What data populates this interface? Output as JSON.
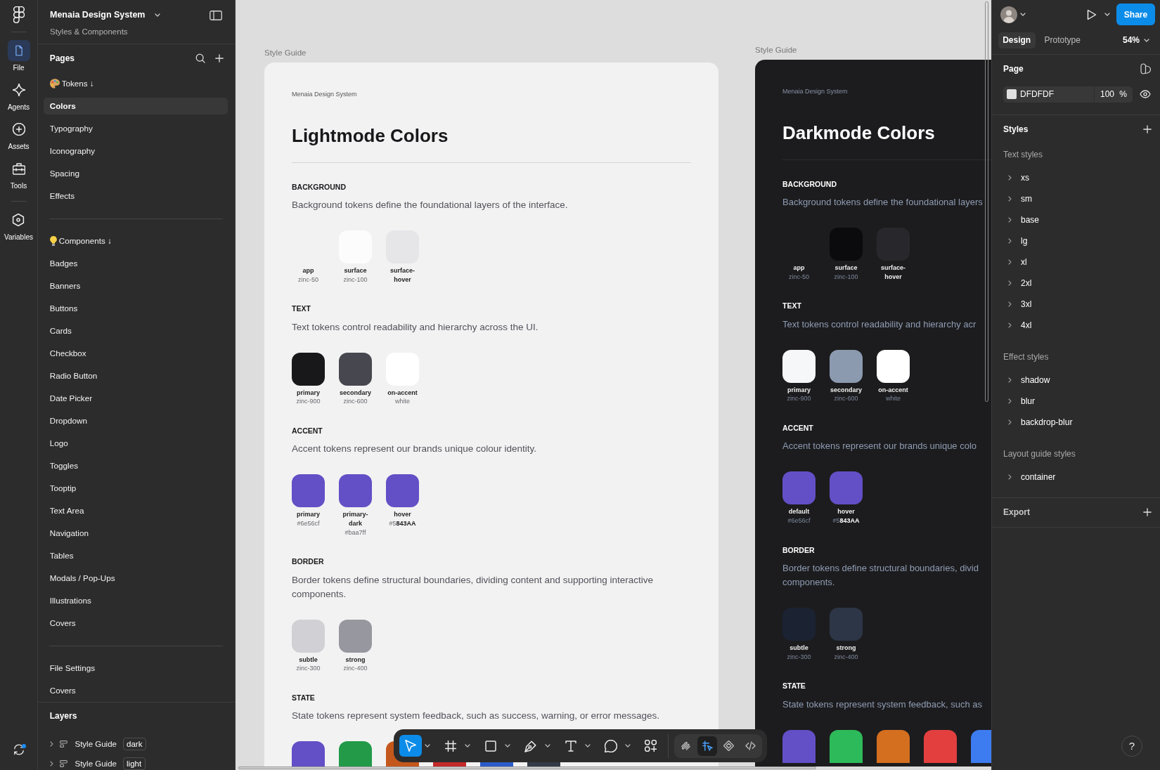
{
  "rail": {
    "items": [
      {
        "label": "File",
        "selected": true
      },
      {
        "label": "Agents",
        "selected": false
      },
      {
        "label": "Assets",
        "selected": false
      },
      {
        "label": "Tools",
        "selected": false
      },
      {
        "label": "Variables",
        "selected": false
      }
    ],
    "sync": {
      "notification": true
    }
  },
  "sidebar": {
    "file_name": "Menaia Design System",
    "file_subtitle": "Styles & Components",
    "pages_title": "Pages",
    "page_groups": [
      {
        "items": [
          {
            "label": "Tokens ↓",
            "kind": "section",
            "selected": false
          },
          {
            "label": "Colors",
            "kind": "page",
            "selected": true
          },
          {
            "label": "Typography",
            "kind": "page",
            "selected": false
          },
          {
            "label": "Iconography",
            "kind": "page",
            "selected": false
          },
          {
            "label": "Spacing",
            "kind": "page",
            "selected": false
          },
          {
            "label": "Effects",
            "kind": "page",
            "selected": false
          }
        ]
      },
      {
        "items": [
          {
            "label": "Components ↓",
            "kind": "section",
            "selected": false
          },
          {
            "label": "Badges",
            "kind": "page",
            "selected": false
          },
          {
            "label": "Banners",
            "kind": "page",
            "selected": false
          },
          {
            "label": "Buttons",
            "kind": "page",
            "selected": false
          },
          {
            "label": "Cards",
            "kind": "page",
            "selected": false
          },
          {
            "label": "Checkbox",
            "kind": "page",
            "selected": false
          },
          {
            "label": "Radio Button",
            "kind": "page",
            "selected": false
          },
          {
            "label": "Date Picker",
            "kind": "page",
            "selected": false
          },
          {
            "label": "Dropdown",
            "kind": "page",
            "selected": false
          },
          {
            "label": "Logo",
            "kind": "page",
            "selected": false
          },
          {
            "label": "Toggles",
            "kind": "page",
            "selected": false
          },
          {
            "label": "Tooptip",
            "kind": "page",
            "selected": false
          },
          {
            "label": "Text Area",
            "kind": "page",
            "selected": false
          },
          {
            "label": "Navigation",
            "kind": "page",
            "selected": false
          },
          {
            "label": "Tables",
            "kind": "page",
            "selected": false
          },
          {
            "label": "Modals / Pop-Ups",
            "kind": "page",
            "selected": false
          },
          {
            "label": "Illustrations",
            "kind": "page",
            "selected": false
          },
          {
            "label": "Covers",
            "kind": "page",
            "selected": false
          }
        ]
      },
      {
        "items": [
          {
            "label": "File Settings",
            "kind": "page",
            "selected": false
          },
          {
            "label": "Covers",
            "kind": "page",
            "selected": false
          }
        ]
      }
    ],
    "layers_title": "Layers",
    "layers": [
      {
        "name": "Style Guide",
        "tag": "dark",
        "expanded": false
      },
      {
        "name": "Style Guide",
        "tag": "light",
        "expanded": false
      }
    ]
  },
  "canvas": {
    "frames": [
      {
        "label": "Style Guide",
        "kind": "light",
        "brand": "Menaia Design System",
        "title": "Lightmode Colors",
        "sections": [
          {
            "heading": "BACKGROUND",
            "description": "Background tokens define the foundational layers of the interface.",
            "swatches": [
              {
                "name": "app",
                "value": "zinc-50"
              },
              {
                "name": "surface",
                "value": "zinc-100",
                "color": "#fcfcfc"
              },
              {
                "name": "surface-hover",
                "color": "#e6e6e9"
              }
            ]
          },
          {
            "heading": "TEXT",
            "description": "Text tokens control readability and hierarchy across the UI.",
            "swatches": [
              {
                "name": "primary",
                "value": "zinc-900",
                "color": "#18181b"
              },
              {
                "name": "secondary",
                "value": "zinc-600",
                "color": "#47474f"
              },
              {
                "name": "on-accent",
                "value": "white",
                "color": "#ffffff"
              }
            ]
          },
          {
            "heading": "ACCENT",
            "description": "Accent tokens represent our brands unique colour identity.",
            "swatches": [
              {
                "name": "primary",
                "value": "#6e56cf",
                "color": "#634fc6"
              },
              {
                "name": "primary-dark",
                "value": "#baa7ff",
                "color": "#634fc6"
              },
              {
                "name": "hover",
                "value": "#5**843AA**",
                "color": "#634fc6"
              }
            ]
          },
          {
            "heading": "BORDER",
            "description": "Border tokens define structural boundaries, dividing content and supporting interactive components.",
            "swatches": [
              {
                "name": "subtle",
                "value": "zinc-300",
                "color": "#d0d0d5"
              },
              {
                "name": "strong",
                "value": "zinc-400",
                "color": "#97979f"
              }
            ]
          },
          {
            "heading": "STATE",
            "description": "State tokens represent system feedback, such as success, warning, or error messages.",
            "swatches": [
              {
                "color": "#634fc6"
              },
              {
                "color": "#229a48"
              },
              {
                "color": "#c4581c"
              },
              {
                "color": "#c42a2a"
              },
              {
                "color": "#2a5bc9"
              },
              {
                "color": "#333b47"
              }
            ]
          }
        ]
      },
      {
        "label": "Style Guide",
        "kind": "dark",
        "brand": "Menaia Design System",
        "title": "Darkmode Colors",
        "sections": [
          {
            "heading": "BACKGROUND",
            "description": "Background tokens define the foundational layers",
            "swatches": [
              {
                "name": "app",
                "value": "zinc-50"
              },
              {
                "name": "surface",
                "value": "zinc-100",
                "color": "#0b0b0d"
              },
              {
                "name": "surface-hover",
                "color": "#28282c"
              }
            ]
          },
          {
            "heading": "TEXT",
            "description": "Text tokens control readability and hierarchy acr",
            "swatches": [
              {
                "name": "primary",
                "value": "zinc-900",
                "color": "#f6f7f9"
              },
              {
                "name": "secondary",
                "value": "zinc-600",
                "color": "#8c9ab0"
              },
              {
                "name": "on-accent",
                "value": "white",
                "color": "#ffffff"
              }
            ]
          },
          {
            "heading": "ACCENT",
            "description": "Accent tokens represent our brands unique colo",
            "swatches": [
              {
                "name": "default",
                "value": "#6e56cf",
                "color": "#634fc6"
              },
              {
                "name": "hover",
                "value": "#5**843AA**",
                "color": "#634fc6"
              }
            ]
          },
          {
            "heading": "BORDER",
            "description": "Border tokens define structural boundaries, divid\ncomponents.",
            "swatches": [
              {
                "name": "subtle",
                "value": "zinc-300",
                "color": "#1b2232"
              },
              {
                "name": "strong",
                "value": "zinc-400",
                "color": "#2c3647"
              }
            ]
          },
          {
            "heading": "STATE",
            "description": "State tokens represent system feedback, such as",
            "swatches": [
              {
                "color": "#634fc6"
              },
              {
                "color": "#2dba5a"
              },
              {
                "color": "#d46f1f"
              },
              {
                "color": "#e33f3f"
              },
              {
                "color": "#3d7cf0"
              }
            ]
          }
        ]
      }
    ]
  },
  "toolbar": {
    "tools": [
      {
        "selected": true,
        "menu": true
      },
      {
        "selected": false,
        "menu": true
      },
      {
        "selected": false,
        "menu": true
      },
      {
        "selected": false,
        "menu": true
      },
      {
        "selected": false,
        "menu": true
      },
      {
        "selected": false,
        "menu": true
      },
      {
        "selected": false,
        "menu": false
      }
    ],
    "modes": [
      {
        "selected": false
      },
      {
        "selected": true
      },
      {
        "selected": false
      },
      {
        "selected": false
      }
    ]
  },
  "inspector": {
    "share": "Share",
    "tabs": [
      {
        "label": "Design",
        "selected": true
      },
      {
        "label": "Prototype",
        "selected": false
      }
    ],
    "zoom": "54%",
    "page": {
      "title": "Page",
      "hex": "DFDFDF",
      "opacity": "100",
      "unit": "%"
    },
    "styles": {
      "title": "Styles",
      "groups": [
        {
          "title": "Text styles",
          "items": [
            {
              "label": "xs",
              "expanded": false
            },
            {
              "label": "sm",
              "expanded": false
            },
            {
              "label": "base",
              "expanded": false
            },
            {
              "label": "lg",
              "expanded": false
            },
            {
              "label": "xl",
              "expanded": false
            },
            {
              "label": "2xl",
              "expanded": false
            },
            {
              "label": "3xl",
              "expanded": false
            },
            {
              "label": "4xl",
              "expanded": false
            }
          ]
        },
        {
          "title": "Effect styles",
          "items": [
            {
              "label": "shadow",
              "expanded": false
            },
            {
              "label": "blur",
              "expanded": false
            },
            {
              "label": "backdrop-blur",
              "expanded": false
            }
          ]
        },
        {
          "title": "Layout guide styles",
          "items": [
            {
              "label": "container",
              "expanded": false
            }
          ]
        }
      ]
    },
    "export": "Export",
    "help": "?"
  }
}
